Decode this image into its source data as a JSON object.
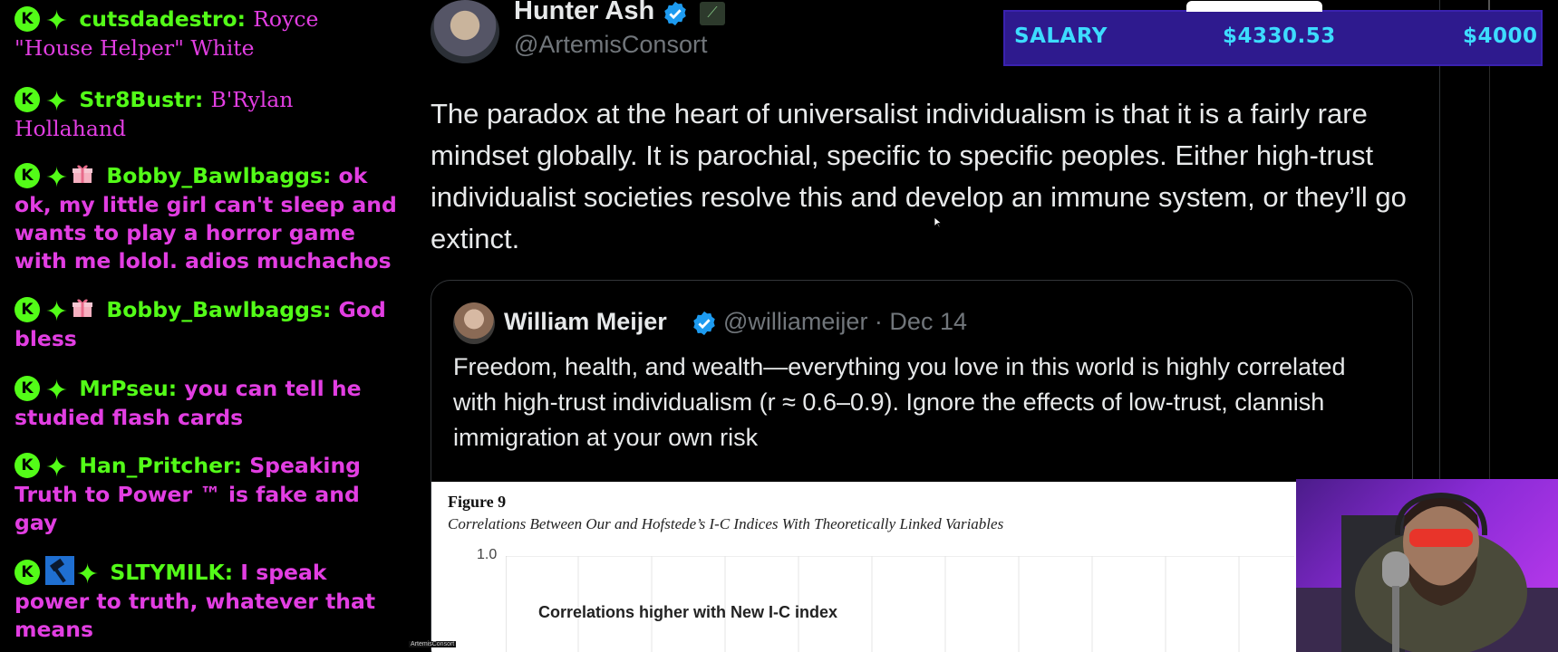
{
  "chat": {
    "messages": [
      {
        "user": "cutsdadestro",
        "text": "Royce \"House Helper\" White",
        "badges": [
          "kick-icon",
          "star-icon"
        ]
      },
      {
        "user": "Str8Bustr",
        "text": "B'Rylan Hollahand",
        "badges": [
          "kick-icon",
          "star-icon"
        ]
      },
      {
        "user": "Bobby_Bawlbaggs",
        "text": "ok ok, my little girl can't sleep and wants to play a horror game with me lolol. adios muchachos",
        "badges": [
          "kick-icon",
          "star-icon",
          "gift-icon"
        ]
      },
      {
        "user": "Bobby_Bawlbaggs",
        "text": "God bless",
        "badges": [
          "kick-icon",
          "star-icon",
          "gift-icon"
        ]
      },
      {
        "user": "MrPseu",
        "text": "you can tell he studied flash cards",
        "badges": [
          "kick-icon",
          "star-icon"
        ]
      },
      {
        "user": "Han_Pritcher",
        "text": "Speaking Truth to Power ™ is fake and gay",
        "badges": [
          "kick-icon",
          "star-icon"
        ]
      },
      {
        "user": "SLTYMILK",
        "text": "I speak power to truth, whatever that means",
        "badges": [
          "kick-icon",
          "hammer-icon",
          "star-icon"
        ]
      }
    ]
  },
  "tweet": {
    "author_name": "Hunter Ash",
    "author_handle": "@ArtemisConsort",
    "text": "The paradox at the heart of universalist individualism is that it is a fairly rare mindset globally. It is parochial, specific to specific peoples. Either high-trust individualist societies resolve this and develop an immune system, or they’ll go extinct.",
    "quote": {
      "author_name": "William Meijer",
      "author_meta": "@williameijer · Dec 14",
      "text": "Freedom, health, and wealth—everything you love in this world is highly correlated with high-trust individualism (r ≈ 0.6–0.9). Ignore the effects of low-trust, clannish immigration at your own risk",
      "figure": {
        "title": "Figure 9",
        "subtitle": "Correlations Between Our and Hofstede’s I-C Indices With Theoretically Linked Variables",
        "tick": "1.0",
        "label": "Correlations higher with New I-C index"
      }
    }
  },
  "salary": {
    "label": "SALARY",
    "current": "$4330.53",
    "goal": "$4000",
    "color": "#3ddcff",
    "background": "#2e1a8e"
  },
  "source_label": "ArtemisConsort"
}
